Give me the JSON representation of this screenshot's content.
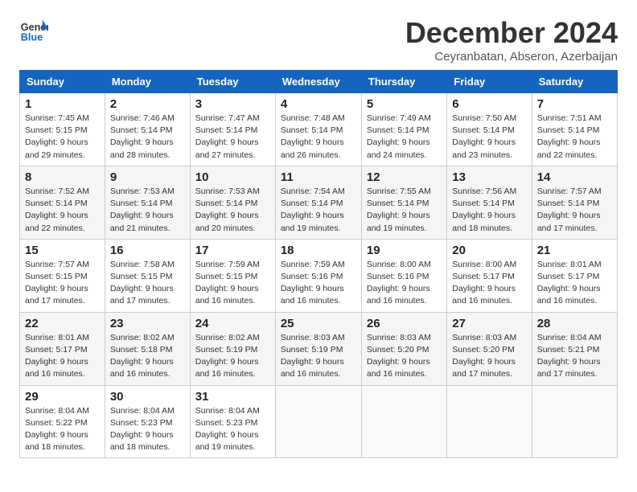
{
  "header": {
    "logo_line1": "General",
    "logo_line2": "Blue",
    "month_title": "December 2024",
    "location": "Ceyranbatan, Abseron, Azerbaijan"
  },
  "weekdays": [
    "Sunday",
    "Monday",
    "Tuesday",
    "Wednesday",
    "Thursday",
    "Friday",
    "Saturday"
  ],
  "weeks": [
    [
      {
        "day": "1",
        "info": "Sunrise: 7:45 AM\nSunset: 5:15 PM\nDaylight: 9 hours\nand 29 minutes."
      },
      {
        "day": "2",
        "info": "Sunrise: 7:46 AM\nSunset: 5:14 PM\nDaylight: 9 hours\nand 28 minutes."
      },
      {
        "day": "3",
        "info": "Sunrise: 7:47 AM\nSunset: 5:14 PM\nDaylight: 9 hours\nand 27 minutes."
      },
      {
        "day": "4",
        "info": "Sunrise: 7:48 AM\nSunset: 5:14 PM\nDaylight: 9 hours\nand 26 minutes."
      },
      {
        "day": "5",
        "info": "Sunrise: 7:49 AM\nSunset: 5:14 PM\nDaylight: 9 hours\nand 24 minutes."
      },
      {
        "day": "6",
        "info": "Sunrise: 7:50 AM\nSunset: 5:14 PM\nDaylight: 9 hours\nand 23 minutes."
      },
      {
        "day": "7",
        "info": "Sunrise: 7:51 AM\nSunset: 5:14 PM\nDaylight: 9 hours\nand 22 minutes."
      }
    ],
    [
      {
        "day": "8",
        "info": "Sunrise: 7:52 AM\nSunset: 5:14 PM\nDaylight: 9 hours\nand 22 minutes."
      },
      {
        "day": "9",
        "info": "Sunrise: 7:53 AM\nSunset: 5:14 PM\nDaylight: 9 hours\nand 21 minutes."
      },
      {
        "day": "10",
        "info": "Sunrise: 7:53 AM\nSunset: 5:14 PM\nDaylight: 9 hours\nand 20 minutes."
      },
      {
        "day": "11",
        "info": "Sunrise: 7:54 AM\nSunset: 5:14 PM\nDaylight: 9 hours\nand 19 minutes."
      },
      {
        "day": "12",
        "info": "Sunrise: 7:55 AM\nSunset: 5:14 PM\nDaylight: 9 hours\nand 19 minutes."
      },
      {
        "day": "13",
        "info": "Sunrise: 7:56 AM\nSunset: 5:14 PM\nDaylight: 9 hours\nand 18 minutes."
      },
      {
        "day": "14",
        "info": "Sunrise: 7:57 AM\nSunset: 5:14 PM\nDaylight: 9 hours\nand 17 minutes."
      }
    ],
    [
      {
        "day": "15",
        "info": "Sunrise: 7:57 AM\nSunset: 5:15 PM\nDaylight: 9 hours\nand 17 minutes."
      },
      {
        "day": "16",
        "info": "Sunrise: 7:58 AM\nSunset: 5:15 PM\nDaylight: 9 hours\nand 17 minutes."
      },
      {
        "day": "17",
        "info": "Sunrise: 7:59 AM\nSunset: 5:15 PM\nDaylight: 9 hours\nand 16 minutes."
      },
      {
        "day": "18",
        "info": "Sunrise: 7:59 AM\nSunset: 5:16 PM\nDaylight: 9 hours\nand 16 minutes."
      },
      {
        "day": "19",
        "info": "Sunrise: 8:00 AM\nSunset: 5:16 PM\nDaylight: 9 hours\nand 16 minutes."
      },
      {
        "day": "20",
        "info": "Sunrise: 8:00 AM\nSunset: 5:17 PM\nDaylight: 9 hours\nand 16 minutes."
      },
      {
        "day": "21",
        "info": "Sunrise: 8:01 AM\nSunset: 5:17 PM\nDaylight: 9 hours\nand 16 minutes."
      }
    ],
    [
      {
        "day": "22",
        "info": "Sunrise: 8:01 AM\nSunset: 5:17 PM\nDaylight: 9 hours\nand 16 minutes."
      },
      {
        "day": "23",
        "info": "Sunrise: 8:02 AM\nSunset: 5:18 PM\nDaylight: 9 hours\nand 16 minutes."
      },
      {
        "day": "24",
        "info": "Sunrise: 8:02 AM\nSunset: 5:19 PM\nDaylight: 9 hours\nand 16 minutes."
      },
      {
        "day": "25",
        "info": "Sunrise: 8:03 AM\nSunset: 5:19 PM\nDaylight: 9 hours\nand 16 minutes."
      },
      {
        "day": "26",
        "info": "Sunrise: 8:03 AM\nSunset: 5:20 PM\nDaylight: 9 hours\nand 16 minutes."
      },
      {
        "day": "27",
        "info": "Sunrise: 8:03 AM\nSunset: 5:20 PM\nDaylight: 9 hours\nand 17 minutes."
      },
      {
        "day": "28",
        "info": "Sunrise: 8:04 AM\nSunset: 5:21 PM\nDaylight: 9 hours\nand 17 minutes."
      }
    ],
    [
      {
        "day": "29",
        "info": "Sunrise: 8:04 AM\nSunset: 5:22 PM\nDaylight: 9 hours\nand 18 minutes."
      },
      {
        "day": "30",
        "info": "Sunrise: 8:04 AM\nSunset: 5:23 PM\nDaylight: 9 hours\nand 18 minutes."
      },
      {
        "day": "31",
        "info": "Sunrise: 8:04 AM\nSunset: 5:23 PM\nDaylight: 9 hours\nand 19 minutes."
      },
      {
        "day": "",
        "info": ""
      },
      {
        "day": "",
        "info": ""
      },
      {
        "day": "",
        "info": ""
      },
      {
        "day": "",
        "info": ""
      }
    ]
  ]
}
